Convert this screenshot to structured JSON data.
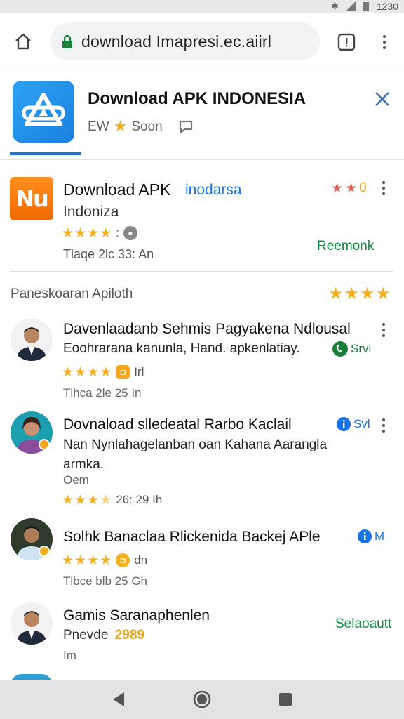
{
  "status_bar": {
    "time": "1230"
  },
  "browser": {
    "url": "download Imapresi.ec.aiirl"
  },
  "app_banner": {
    "title": "Download APK INDONESIA",
    "meta_prefix": "EW",
    "meta_status": "Soon"
  },
  "featured_app": {
    "title": "Download APK",
    "tag": "inodarsa",
    "subtitle": "Indoniza",
    "rating_stars": 4,
    "meta": "Tlaqe 2lc 33: An",
    "right_score": "0",
    "action": "Reemonk"
  },
  "section": {
    "heading": "Paneskoaran Apiloth",
    "rating_stars": 4
  },
  "items": [
    {
      "title": "Davenlaadanb Sehmis Pagyakena Ndlousal",
      "description": "Eoohrarana kanunla, Hand. apkenlatiay.",
      "rating_stars": 4,
      "badge": "Irl",
      "meta": "Tlhca 2le 25 In",
      "tag": "Srvi",
      "tag_color": "#188038"
    },
    {
      "title": "Dovnaload slledeatal Rarbo Kaclail",
      "description": "Nan Nynlahagelanban oan Kahana Aarangla armka.",
      "extra": "Oem",
      "rating_stars": 3,
      "rating_text": "26: 29 Ih",
      "tag": "Svl",
      "tag_color": "#1a73e8"
    },
    {
      "title": "Solhk Banaclaa Rlickenida Backej APle",
      "rating_stars": 4,
      "badge": "dn",
      "meta": "Tlbce blb 25 Gh",
      "tag": "M",
      "tag_color": "#1a73e8"
    },
    {
      "title": "Gamis Saranaphenlen",
      "subtitle": "Pnevde",
      "highlight": "2989",
      "meta": "Im",
      "action": "Selaoautt"
    }
  ],
  "colors": {
    "accent": "#1a73e8",
    "install_green": "#0f8a3c",
    "star": "#f2b01e",
    "featured_icon": "#f06a00"
  }
}
